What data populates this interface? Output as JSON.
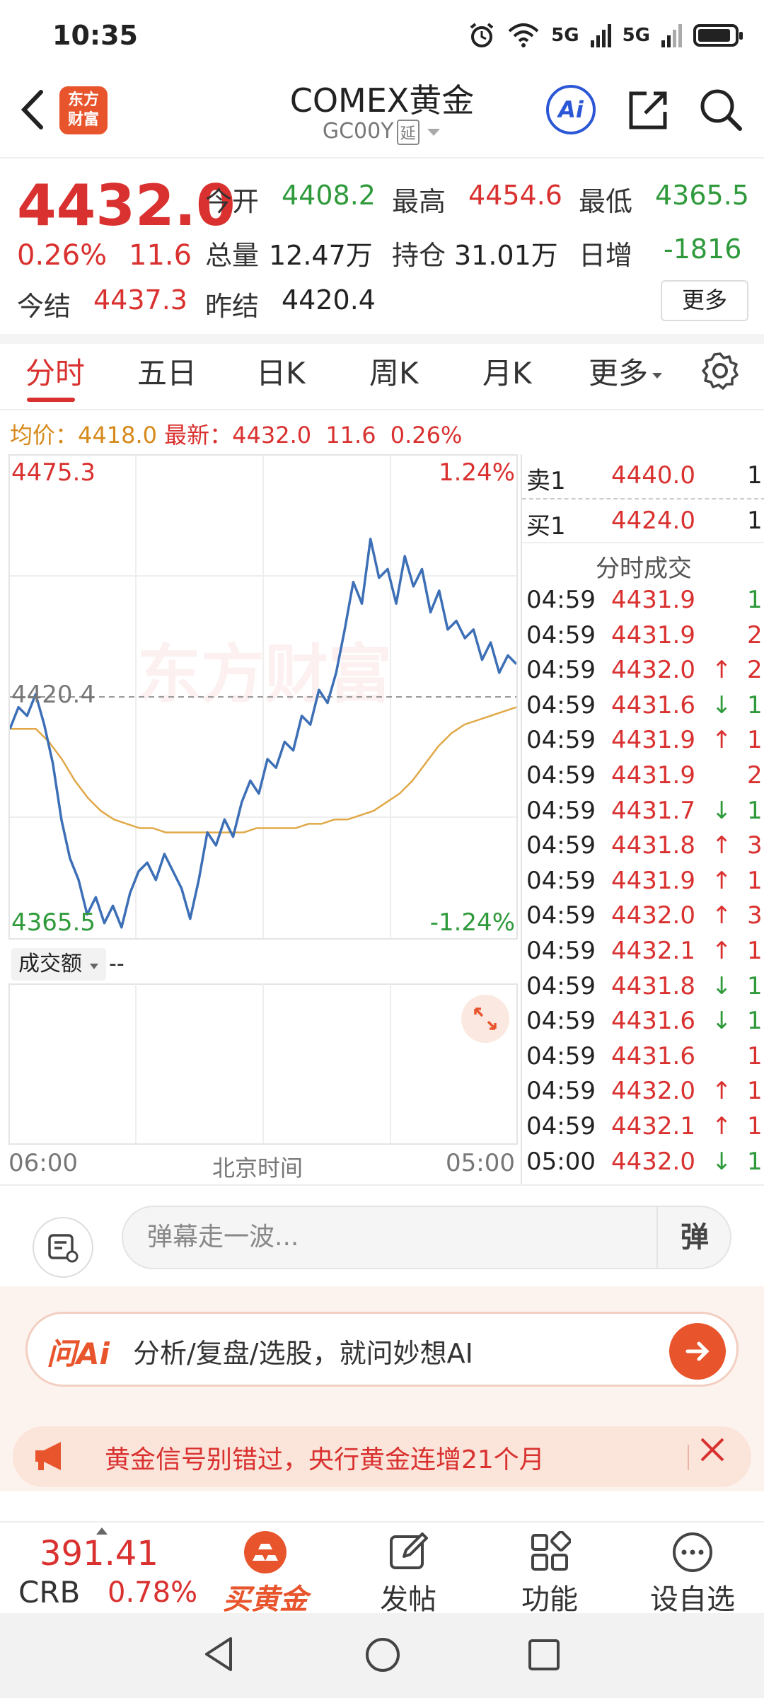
{
  "status_bar": {
    "time": "10:35",
    "net1": "5G",
    "net2": "5G"
  },
  "header": {
    "logo_text": "东方财富",
    "title": "COMEX黄金",
    "code": "GC00Y",
    "delay_tag": "延",
    "ai_label": "Ai"
  },
  "quote": {
    "price": "4432.0",
    "change_pct": "0.26%",
    "change": "11.6",
    "fields": [
      {
        "label": "今开",
        "value": "4408.2",
        "color": "green"
      },
      {
        "label": "最高",
        "value": "4454.6",
        "color": "red"
      },
      {
        "label": "最低",
        "value": "4365.5",
        "color": "green"
      },
      {
        "label": "总量",
        "value": "12.47万",
        "color": "black"
      },
      {
        "label": "持仓",
        "value": "31.01万",
        "color": "black"
      },
      {
        "label": "日增",
        "value": "-1816",
        "color": "green"
      },
      {
        "label": "今结",
        "value": "4437.3",
        "color": "red"
      },
      {
        "label": "昨结",
        "value": "4420.4",
        "color": "black"
      }
    ],
    "more_label": "更多"
  },
  "tabs": [
    "分时",
    "五日",
    "日K",
    "周K",
    "月K",
    "更多"
  ],
  "info_line": {
    "avg_label": "均价：",
    "avg_value": "4418.0",
    "latest_label": "最新：",
    "latest_value": "4432.0",
    "latest_change": "11.6",
    "latest_pct": "0.26%"
  },
  "chart_data": {
    "type": "line",
    "series": [
      {
        "values": [
          4413,
          4418,
          4416,
          4421,
          4414,
          4405,
          4392,
          4383,
          4378,
          4370,
          4374,
          4368,
          4372,
          4367,
          4375,
          4380,
          4382,
          4378,
          4384,
          4380,
          4376,
          4369,
          4378,
          4389,
          4386,
          4392,
          4388,
          4396,
          4401,
          4398,
          4406,
          4404,
          4410,
          4408,
          4416,
          4414,
          4422,
          4419,
          4426,
          4436,
          4447,
          4442,
          4457,
          4448,
          4450,
          4442,
          4453,
          4446,
          4450,
          4440,
          4445,
          4436,
          4438,
          4434,
          4436,
          4429,
          4433,
          4426,
          4430,
          4428
        ]
      },
      {
        "values": [
          4413,
          4413,
          4413,
          4410,
          4406,
          4401,
          4397,
          4394,
          4392,
          4391,
          4390,
          4390,
          4389,
          4389,
          4389,
          4389,
          4389,
          4389,
          4389,
          4390,
          4390,
          4390,
          4390,
          4391,
          4391,
          4392,
          4392,
          4393,
          4394,
          4396,
          4398,
          4401,
          4405,
          4409,
          4412,
          4414,
          4415,
          4416,
          4417,
          4418
        ]
      }
    ],
    "y_max_label": "4475.3",
    "y_min_label": "4365.5",
    "pct_max_label": "1.24%",
    "pct_min_label": "-1.24%",
    "ref_label": "4420.4",
    "ref_value": 4420.4,
    "ylim": [
      4365.5,
      4475.3
    ],
    "x_start_label": "06:00",
    "x_mid_label": "北京时间",
    "x_end_label": "05:00",
    "volume_selector": "成交额",
    "volume_value": "--"
  },
  "watermark": "东方财富",
  "order_book": {
    "ask_label": "卖1",
    "ask_price": "4440.0",
    "ask_qty": "1",
    "bid_label": "买1",
    "bid_price": "4424.0",
    "bid_qty": "1"
  },
  "trades_title": "分时成交",
  "trades": [
    {
      "time": "04:59",
      "price": "4431.9",
      "dir": "",
      "qty": "1"
    },
    {
      "time": "04:59",
      "price": "4431.9",
      "dir": "",
      "qty": "2"
    },
    {
      "time": "04:59",
      "price": "4432.0",
      "dir": "↑",
      "qty": "2"
    },
    {
      "time": "04:59",
      "price": "4431.6",
      "dir": "↓",
      "qty": "1"
    },
    {
      "time": "04:59",
      "price": "4431.9",
      "dir": "↑",
      "qty": "1"
    },
    {
      "time": "04:59",
      "price": "4431.9",
      "dir": "",
      "qty": "2"
    },
    {
      "time": "04:59",
      "price": "4431.7",
      "dir": "↓",
      "qty": "1"
    },
    {
      "time": "04:59",
      "price": "4431.8",
      "dir": "↑",
      "qty": "3"
    },
    {
      "time": "04:59",
      "price": "4431.9",
      "dir": "↑",
      "qty": "1"
    },
    {
      "time": "04:59",
      "price": "4432.0",
      "dir": "↑",
      "qty": "3"
    },
    {
      "time": "04:59",
      "price": "4432.1",
      "dir": "↑",
      "qty": "1"
    },
    {
      "time": "04:59",
      "price": "4431.8",
      "dir": "↓",
      "qty": "1"
    },
    {
      "time": "04:59",
      "price": "4431.6",
      "dir": "↓",
      "qty": "1"
    },
    {
      "time": "04:59",
      "price": "4431.6",
      "dir": "",
      "qty": "1"
    },
    {
      "time": "04:59",
      "price": "4432.0",
      "dir": "↑",
      "qty": "1"
    },
    {
      "time": "04:59",
      "price": "4432.1",
      "dir": "↑",
      "qty": "1"
    },
    {
      "time": "05:00",
      "price": "4432.0",
      "dir": "↓",
      "qty": "1"
    }
  ],
  "barrage": {
    "placeholder": "弹幕走一波...",
    "send_label": "弹"
  },
  "ai_prompt": {
    "logo": "问Ai",
    "text": "分析/复盘/选股，就问妙想AI"
  },
  "notice": {
    "text": "黄金信号别错过，央行黄金连增21个月"
  },
  "bottom_nav": {
    "index_value": "391.41",
    "index_name": "CRB",
    "index_pct": "0.78%",
    "items": [
      "买黄金",
      "发帖",
      "功能",
      "设自选"
    ]
  },
  "colors": {
    "up": "#d9312f",
    "down": "#2f9a3b",
    "accent": "#e8552d",
    "line": "#3d6fb6",
    "avg": "#e0a847"
  }
}
